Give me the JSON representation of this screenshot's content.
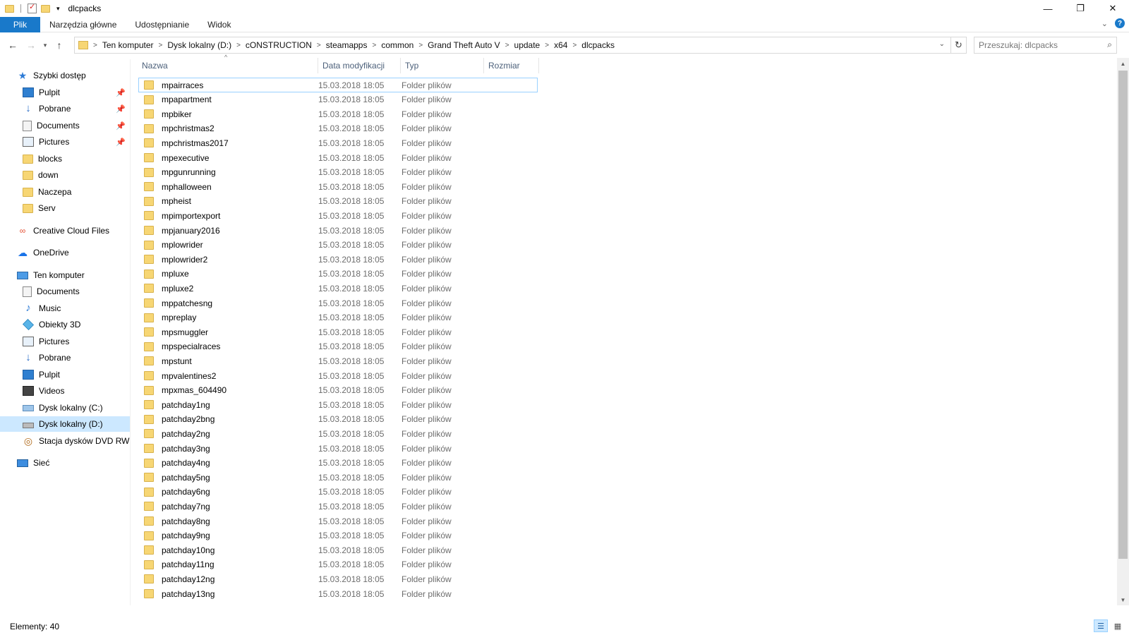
{
  "window": {
    "title": "dlcpacks",
    "minimize_glyph": "—",
    "restore_glyph": "❐",
    "close_glyph": "✕"
  },
  "ribbon": {
    "tabs": [
      "Plik",
      "Narzędzia główne",
      "Udostępnianie",
      "Widok"
    ],
    "help_glyph": "?"
  },
  "address": {
    "breadcrumbs": [
      "Ten komputer",
      "Dysk lokalny (D:)",
      "cONSTRUCTION",
      "steamapps",
      "common",
      "Grand Theft Auto V",
      "update",
      "x64",
      "dlcpacks"
    ]
  },
  "search": {
    "placeholder": "Przeszukaj: dlcpacks"
  },
  "navigation": {
    "quick_access": "Szybki dostęp",
    "quick_items": [
      "Pulpit",
      "Pobrane",
      "Documents",
      "Pictures",
      "blocks",
      "down",
      "Naczepa",
      "Serv"
    ],
    "creative_cloud": "Creative Cloud Files",
    "onedrive": "OneDrive",
    "this_pc": "Ten komputer",
    "pc_items": [
      "Documents",
      "Music",
      "Obiekty 3D",
      "Pictures",
      "Pobrane",
      "Pulpit",
      "Videos",
      "Dysk lokalny (C:)",
      "Dysk lokalny (D:)",
      "Stacja dysków DVD RW (E"
    ],
    "selected": "Dysk lokalny (D:)",
    "network": "Sieć"
  },
  "columns": {
    "name": "Nazwa",
    "date": "Data modyfikacji",
    "type": "Typ",
    "size": "Rozmiar"
  },
  "files": [
    {
      "name": "mpairraces",
      "date": "15.03.2018 18:05",
      "type": "Folder plików"
    },
    {
      "name": "mpapartment",
      "date": "15.03.2018 18:05",
      "type": "Folder plików"
    },
    {
      "name": "mpbiker",
      "date": "15.03.2018 18:05",
      "type": "Folder plików"
    },
    {
      "name": "mpchristmas2",
      "date": "15.03.2018 18:05",
      "type": "Folder plików"
    },
    {
      "name": "mpchristmas2017",
      "date": "15.03.2018 18:05",
      "type": "Folder plików"
    },
    {
      "name": "mpexecutive",
      "date": "15.03.2018 18:05",
      "type": "Folder plików"
    },
    {
      "name": "mpgunrunning",
      "date": "15.03.2018 18:05",
      "type": "Folder plików"
    },
    {
      "name": "mphalloween",
      "date": "15.03.2018 18:05",
      "type": "Folder plików"
    },
    {
      "name": "mpheist",
      "date": "15.03.2018 18:05",
      "type": "Folder plików"
    },
    {
      "name": "mpimportexport",
      "date": "15.03.2018 18:05",
      "type": "Folder plików"
    },
    {
      "name": "mpjanuary2016",
      "date": "15.03.2018 18:05",
      "type": "Folder plików"
    },
    {
      "name": "mplowrider",
      "date": "15.03.2018 18:05",
      "type": "Folder plików"
    },
    {
      "name": "mplowrider2",
      "date": "15.03.2018 18:05",
      "type": "Folder plików"
    },
    {
      "name": "mpluxe",
      "date": "15.03.2018 18:05",
      "type": "Folder plików"
    },
    {
      "name": "mpluxe2",
      "date": "15.03.2018 18:05",
      "type": "Folder plików"
    },
    {
      "name": "mppatchesng",
      "date": "15.03.2018 18:05",
      "type": "Folder plików"
    },
    {
      "name": "mpreplay",
      "date": "15.03.2018 18:05",
      "type": "Folder plików"
    },
    {
      "name": "mpsmuggler",
      "date": "15.03.2018 18:05",
      "type": "Folder plików"
    },
    {
      "name": "mpspecialraces",
      "date": "15.03.2018 18:05",
      "type": "Folder plików"
    },
    {
      "name": "mpstunt",
      "date": "15.03.2018 18:05",
      "type": "Folder plików"
    },
    {
      "name": "mpvalentines2",
      "date": "15.03.2018 18:05",
      "type": "Folder plików"
    },
    {
      "name": "mpxmas_604490",
      "date": "15.03.2018 18:05",
      "type": "Folder plików"
    },
    {
      "name": "patchday1ng",
      "date": "15.03.2018 18:05",
      "type": "Folder plików"
    },
    {
      "name": "patchday2bng",
      "date": "15.03.2018 18:05",
      "type": "Folder plików"
    },
    {
      "name": "patchday2ng",
      "date": "15.03.2018 18:05",
      "type": "Folder plików"
    },
    {
      "name": "patchday3ng",
      "date": "15.03.2018 18:05",
      "type": "Folder plików"
    },
    {
      "name": "patchday4ng",
      "date": "15.03.2018 18:05",
      "type": "Folder plików"
    },
    {
      "name": "patchday5ng",
      "date": "15.03.2018 18:05",
      "type": "Folder plików"
    },
    {
      "name": "patchday6ng",
      "date": "15.03.2018 18:05",
      "type": "Folder plików"
    },
    {
      "name": "patchday7ng",
      "date": "15.03.2018 18:05",
      "type": "Folder plików"
    },
    {
      "name": "patchday8ng",
      "date": "15.03.2018 18:05",
      "type": "Folder plików"
    },
    {
      "name": "patchday9ng",
      "date": "15.03.2018 18:05",
      "type": "Folder plików"
    },
    {
      "name": "patchday10ng",
      "date": "15.03.2018 18:05",
      "type": "Folder plików"
    },
    {
      "name": "patchday11ng",
      "date": "15.03.2018 18:05",
      "type": "Folder plików"
    },
    {
      "name": "patchday12ng",
      "date": "15.03.2018 18:05",
      "type": "Folder plików"
    },
    {
      "name": "patchday13ng",
      "date": "15.03.2018 18:05",
      "type": "Folder plików"
    }
  ],
  "status": {
    "count_text": "Elementy: 40"
  },
  "colors": {
    "accent": "#1979ca",
    "folder": "#f7d674",
    "selection": "#cce8ff"
  }
}
